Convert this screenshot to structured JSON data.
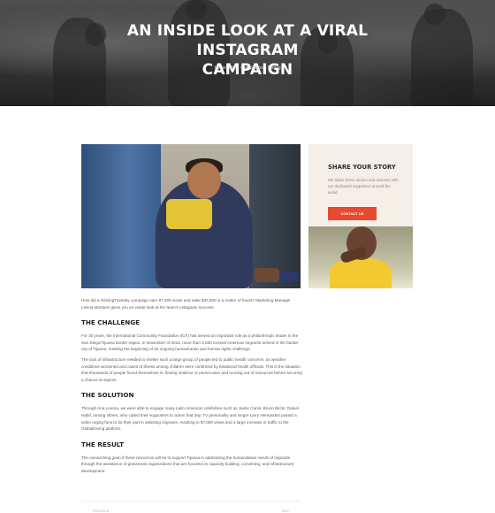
{
  "hero": {
    "title_line1": "AN INSIDE LOOK AT A VIRAL INSTAGRAM",
    "title_line2": "CAMPAIGN",
    "breadcrumbs": [
      "Homepage",
      "Campaigns",
      "Listing"
    ]
  },
  "article": {
    "intro": "How did a #GivingTuesday campaign earn 87,000 views and raise $30,000 in a matter of hours? Marketing Manager Leticia Martinez gives you an inside look at her team's Instagram success.",
    "sections": [
      {
        "heading": "THE CHALLENGE",
        "paragraphs": [
          "For 30 years, the International Community Foundation (ICF) has served an important role as a philanthropic leader in the San Diego/Tijuana border region. In November of 2018, more than 5,000 Central American migrants arrived in the border city of Tijuana, marking the beginning of an ongoing humanitarian and human rights challenge.",
          "The lack of infrastructure needed to shelter such a large group of people led to public health concerns, as weather conditions worsened and cases of illness among children were confirmed by binational health officials. This is the situation that thousands of people found themselves in, fleeing violence or persecution and running out of resources before securing a chance at asylum."
        ]
      },
      {
        "heading": "THE SOLUTION",
        "paragraphs": [
          "Through Ana Lorena, we were able to engage many Latin American celebrities such as Jaime Camil, Bruno Bichir, Daniel Habif, among others, who called their supporters to action that day. TV personality and singer Larry Hernandez posted a video urging fans to do their part in assisting migrants, resulting in 87,000 views and a large increase in traffic to the GlobalGiving platform."
        ]
      },
      {
        "heading": "THE RESULT",
        "paragraphs": [
          "The overarching goal of these resources will be to support Tijuana in addressing the humanitarian needs of migrants through the assistance of grassroots organizations that are focused on capacity building, convening, and infrastructure development."
        ]
      }
    ],
    "pager": {
      "prev": "PREVIOUS",
      "next": "NEXT"
    }
  },
  "sidebar": {
    "title": "SHARE YOUR STORY",
    "text": "We share these stories and victories with our dedicated supporters around the world.",
    "button_label": "CONTACT US"
  },
  "colors": {
    "accent": "#e84a2f",
    "sidebar_bg": "#f5efe8",
    "heading": "#222222"
  }
}
